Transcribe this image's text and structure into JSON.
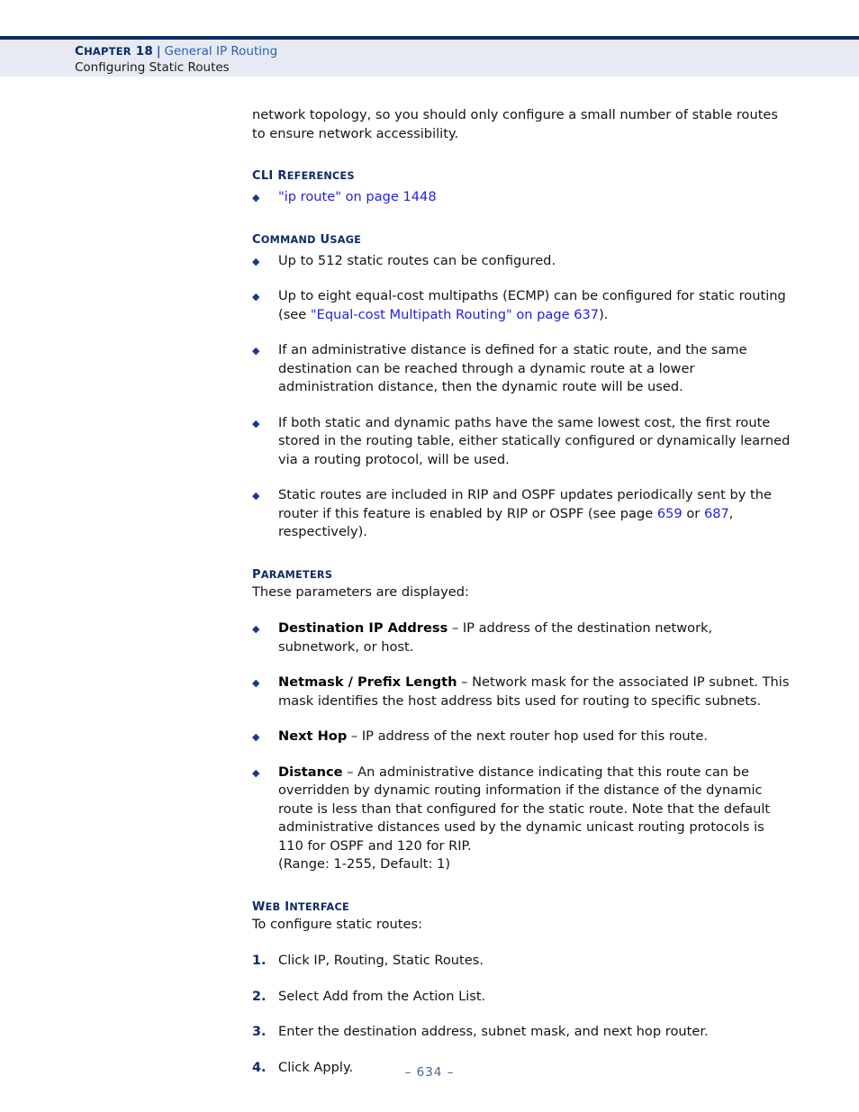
{
  "header": {
    "chapter_label": "CHAPTER 18",
    "separator": "|",
    "chapter_title": "General IP Routing",
    "section_title": "Configuring Static Routes"
  },
  "intro": {
    "paragraph": "network topology, so you should only configure a small number of stable routes to ensure network accessibility."
  },
  "cli_references": {
    "heading": "CLI REFERENCES",
    "items": [
      {
        "link": "\"ip route\" on page 1448"
      }
    ]
  },
  "command_usage": {
    "heading": "COMMAND USAGE",
    "items": [
      {
        "text": "Up to 512 static routes can be configured."
      },
      {
        "pre": "Up to eight equal-cost multipaths (ECMP) can be configured for static routing (see ",
        "link": "\"Equal-cost Multipath Routing\" on page 637",
        "post": ")."
      },
      {
        "text": "If an administrative distance is defined for a static route, and the same destination can be reached through a dynamic route at a lower administration distance, then the dynamic route will be used."
      },
      {
        "text": "If both static and dynamic paths have the same lowest cost, the first route stored in the routing table, either statically configured or dynamically learned via a routing protocol, will be used."
      },
      {
        "pre": "Static routes are included in RIP and OSPF updates periodically sent by the router if this feature is enabled by RIP or OSPF (see page ",
        "link": "659",
        "mid": " or ",
        "link2": "687",
        "post": ", respectively)."
      }
    ]
  },
  "parameters": {
    "heading": "PARAMETERS",
    "intro": "These parameters are displayed:",
    "items": [
      {
        "term": "Destination IP Address",
        "desc": " – IP address of the destination network, subnetwork, or host."
      },
      {
        "term": "Netmask / Prefix Length",
        "desc": " – Network mask for the associated IP subnet. This mask identifies the host address bits used for routing to specific subnets."
      },
      {
        "term": "Next Hop",
        "desc": " – IP address of the next router hop used for this route."
      },
      {
        "term": "Distance",
        "desc": " – An administrative distance indicating that this route can be overridden by dynamic routing information if the distance of the dynamic route is less than that configured for the static route. Note that the default administrative distances used by the dynamic unicast routing protocols is 110 for OSPF and 120 for RIP.",
        "range": "(Range: 1-255, Default: 1)"
      }
    ]
  },
  "web_interface": {
    "heading": "WEB INTERFACE",
    "intro": "To configure static routes:",
    "steps": [
      {
        "num": "1.",
        "text": "Click IP, Routing, Static Routes."
      },
      {
        "num": "2.",
        "text": "Select Add from the Action List."
      },
      {
        "num": "3.",
        "text": "Enter the destination address, subnet mask, and next hop router."
      },
      {
        "num": "4.",
        "text": "Click Apply."
      }
    ]
  },
  "footer": {
    "page_number": "–  634  –"
  },
  "icons": {
    "bullet": "◆"
  },
  "colors": {
    "navy": "#0b2a66",
    "link_blue": "#2222dd",
    "header_band": "#e7eaf2",
    "footer_text": "#4a6393"
  }
}
